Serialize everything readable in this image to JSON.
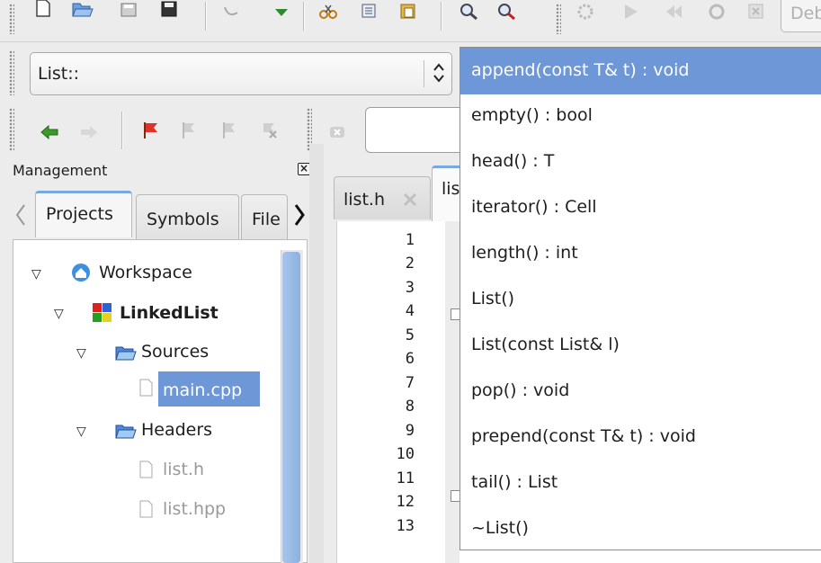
{
  "toolbar_top": {
    "build_config_partial": "Deb"
  },
  "class_combo": {
    "value": "List::"
  },
  "management": {
    "title": "Management",
    "tabs": [
      "Projects",
      "Symbols",
      "File"
    ],
    "tree": {
      "workspace": "Workspace",
      "project": "LinkedList",
      "sources_folder": "Sources",
      "sources_files": [
        "main.cpp"
      ],
      "headers_folder": "Headers",
      "headers_files": [
        "list.h",
        "list.hpp"
      ]
    }
  },
  "editor": {
    "tabs": [
      "list.h",
      "lis"
    ],
    "line_numbers": [
      "1",
      "2",
      "3",
      "4",
      "5",
      "6",
      "7",
      "8",
      "9",
      "10",
      "11",
      "12",
      "13"
    ]
  },
  "completion": {
    "items": [
      "append(const T& t) : void",
      "empty() : bool",
      "head() : T",
      "iterator() : Cell",
      "length() : int",
      "List()",
      "List(const List& l)",
      "pop() : void",
      "prepend(const T& t) : void",
      "tail() : List",
      "~List()"
    ],
    "selected_index": 0
  },
  "colors": {
    "selection": "#6d97d6",
    "tree_selection": "#6d97d6",
    "scroll_thumb": "#8cb0e2"
  },
  "icons": {
    "toolbar_top": [
      "new-file-icon",
      "open-folder-icon",
      "save-icon",
      "save-all-icon",
      "undo-icon",
      "redo-icon",
      "cut-icon",
      "copy-icon",
      "paste-icon",
      "find-icon",
      "replace-icon",
      "settings-icon",
      "run-icon",
      "build-run-icon",
      "rebuild-icon",
      "stop-icon"
    ],
    "toolbar_second": [
      "back-arrow-icon",
      "forward-arrow-icon",
      "bookmark-flag-icon",
      "prev-bookmark-icon",
      "next-bookmark-icon",
      "clear-bookmark-icon",
      "search-icon"
    ]
  }
}
